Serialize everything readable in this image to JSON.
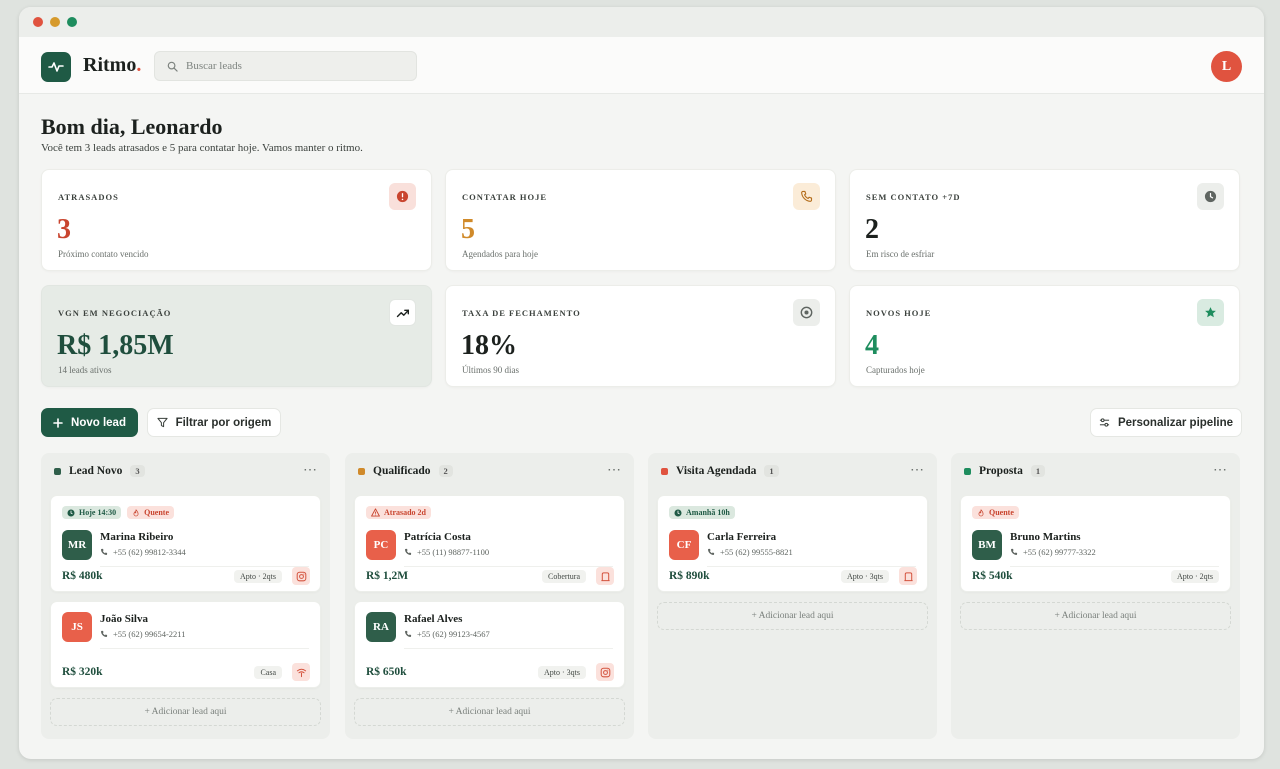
{
  "app": {
    "brand": "Ritmo",
    "brand_dot": "."
  },
  "search": {
    "placeholder": "Buscar leads"
  },
  "user": {
    "initial": "L"
  },
  "greeting": {
    "title": "Bom dia, Leonardo",
    "subtitle": "Você tem 3 leads atrasados e 5 para contatar hoje. Vamos manter o ritmo."
  },
  "stats": [
    {
      "label": "ATRASADOS",
      "value": "3",
      "sub": "Próximo contato vencido",
      "icon": "alert-icon",
      "color": "#c9452f"
    },
    {
      "label": "CONTATAR HOJE",
      "value": "5",
      "sub": "Agendados para hoje",
      "icon": "phone-icon",
      "color": "#d08a2a"
    },
    {
      "label": "SEM CONTATO +7D",
      "value": "2",
      "sub": "Em risco de esfriar",
      "icon": "clock-icon",
      "color": "#1c211e"
    },
    {
      "label": "VGN EM NEGOCIAÇÃO",
      "value": "R$ 1,85M",
      "sub": "14 leads ativos",
      "icon": "trending-up-icon",
      "color": "#1f4e3d"
    },
    {
      "label": "TAXA DE FECHAMENTO",
      "value": "18%",
      "sub": "Últimos 90 dias",
      "icon": "target-icon",
      "color": "#1c211e"
    },
    {
      "label": "NOVOS HOJE",
      "value": "4",
      "sub": "Capturados hoje",
      "icon": "star-icon",
      "color": "#1e8d5e"
    }
  ],
  "actions": {
    "new_lead": "Novo lead",
    "filter": "Filtrar por origem",
    "customize": "Personalizar pipeline"
  },
  "add_here": "+ Adicionar lead aqui",
  "columns": [
    {
      "title": "Lead Novo",
      "count": "3",
      "color": "#2f5e4a",
      "cards": [
        {
          "tags": [
            {
              "kind": "green",
              "icon": "clock",
              "text": "Hoje 14:30"
            },
            {
              "kind": "hot",
              "icon": "flame",
              "text": "Quente"
            }
          ],
          "initials": "MR",
          "avatar": "dg",
          "name": "Marina Ribeiro",
          "phone": "+55 (62) 99812-3344",
          "price": "R$ 480k",
          "type": "Apto · 2qts",
          "source": "instagram-icon"
        },
        {
          "tags": [],
          "initials": "JS",
          "avatar": "or",
          "name": "João Silva",
          "phone": "+55 (62) 99654-2211",
          "price": "R$ 320k",
          "type": "Casa",
          "source": "portal-icon"
        }
      ]
    },
    {
      "title": "Qualificado",
      "count": "2",
      "color": "#d08a2a",
      "cards": [
        {
          "tags": [
            {
              "kind": "hot",
              "icon": "warn",
              "text": "Atrasado 2d"
            }
          ],
          "initials": "PC",
          "avatar": "or",
          "name": "Patrícia Costa",
          "phone": "+55 (11) 98877-1100",
          "price": "R$ 1,2M",
          "type": "Cobertura",
          "source": "building-icon"
        },
        {
          "tags": [],
          "initials": "RA",
          "avatar": "dg",
          "name": "Rafael Alves",
          "phone": "+55 (62) 99123-4567",
          "price": "R$ 650k",
          "type": "Apto · 3qts",
          "source": "instagram-icon"
        }
      ]
    },
    {
      "title": "Visita Agendada",
      "count": "1",
      "color": "#e0533f",
      "cards": [
        {
          "tags": [
            {
              "kind": "green",
              "icon": "clock",
              "text": "Amanhã 10h"
            }
          ],
          "initials": "CF",
          "avatar": "or",
          "name": "Carla Ferreira",
          "phone": "+55 (62) 99555-8821",
          "price": "R$ 890k",
          "type": "Apto · 3qts",
          "source": "building-icon"
        }
      ]
    },
    {
      "title": "Proposta",
      "count": "1",
      "color": "#1e8d5e",
      "cards": [
        {
          "tags": [
            {
              "kind": "hot",
              "icon": "flame",
              "text": "Quente"
            }
          ],
          "initials": "BM",
          "avatar": "dg",
          "name": "Bruno Martins",
          "phone": "+55 (62) 99777-3322",
          "price": "R$ 540k",
          "type": "Apto · 2qts",
          "source": ""
        }
      ]
    }
  ]
}
